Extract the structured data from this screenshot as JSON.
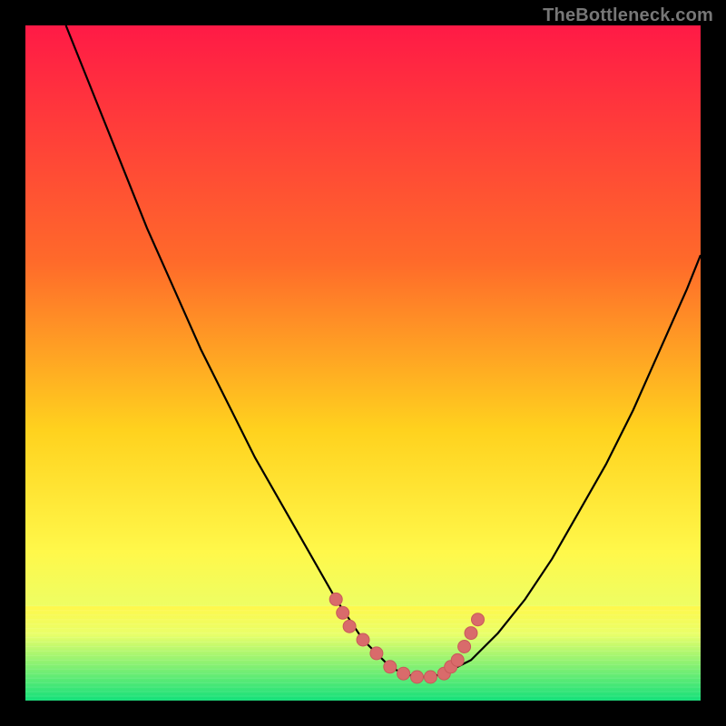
{
  "watermark": "TheBottleneck.com",
  "colors": {
    "frame_bg": "#000000",
    "grad_top": "#ff1a46",
    "grad_mid1": "#ff6a2a",
    "grad_mid2": "#ffd21e",
    "grad_mid3": "#fff84a",
    "grad_mid4": "#e9ff6a",
    "grad_bottom": "#15e07a",
    "curve": "#000000",
    "marker_fill": "#d96b6b",
    "marker_stroke": "#c85a5a"
  },
  "chart_data": {
    "type": "line",
    "title": "",
    "xlabel": "",
    "ylabel": "",
    "xlim": [
      0,
      100
    ],
    "ylim": [
      0,
      100
    ],
    "series": [
      {
        "name": "bottleneck-curve",
        "x": [
          6,
          10,
          14,
          18,
          22,
          26,
          30,
          34,
          38,
          42,
          46,
          48,
          50,
          52,
          54,
          56,
          58,
          60,
          62,
          66,
          70,
          74,
          78,
          82,
          86,
          90,
          94,
          98,
          100
        ],
        "y": [
          100,
          90,
          80,
          70,
          61,
          52,
          44,
          36,
          29,
          22,
          15,
          12,
          9,
          7,
          5,
          4,
          3.5,
          3.5,
          4,
          6,
          10,
          15,
          21,
          28,
          35,
          43,
          52,
          61,
          66
        ]
      }
    ],
    "markers": {
      "name": "highlight-dots",
      "points": [
        {
          "x": 46,
          "y": 15
        },
        {
          "x": 47,
          "y": 13
        },
        {
          "x": 48,
          "y": 11
        },
        {
          "x": 50,
          "y": 9
        },
        {
          "x": 52,
          "y": 7
        },
        {
          "x": 54,
          "y": 5
        },
        {
          "x": 56,
          "y": 4
        },
        {
          "x": 58,
          "y": 3.5
        },
        {
          "x": 60,
          "y": 3.5
        },
        {
          "x": 62,
          "y": 4
        },
        {
          "x": 63,
          "y": 5
        },
        {
          "x": 64,
          "y": 6
        },
        {
          "x": 65,
          "y": 8
        },
        {
          "x": 66,
          "y": 10
        },
        {
          "x": 67,
          "y": 12
        }
      ]
    },
    "bottom_band_start_y": 14
  }
}
